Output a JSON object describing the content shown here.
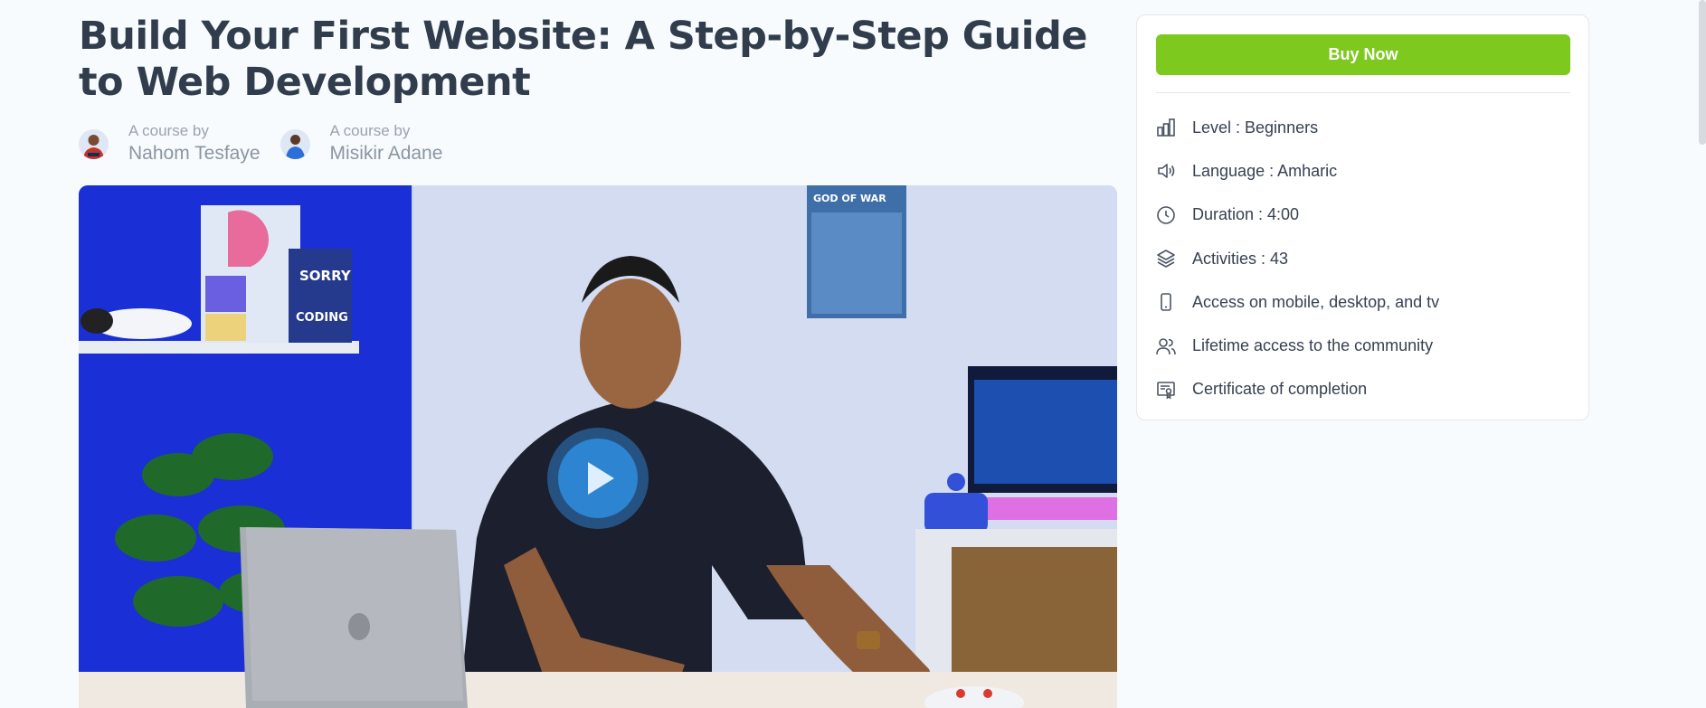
{
  "course": {
    "title": "Build Your First Website: A Step-by-Step Guide to Web Development",
    "authors": [
      {
        "by": "A course by",
        "name": "Nahom Tesfaye"
      },
      {
        "by": "A course by",
        "name": "Misikir Adane"
      }
    ]
  },
  "video": {
    "poster_text": {
      "box_line1": "SORRY",
      "box_line2": "CODING",
      "poster_top": "GOD OF WAR"
    },
    "play_icon": "play-icon"
  },
  "sidebar": {
    "buy_label": "Buy Now",
    "features": [
      {
        "icon": "level-bars-icon",
        "text": "Level : Beginners"
      },
      {
        "icon": "speaker-icon",
        "text": "Language : Amharic"
      },
      {
        "icon": "clock-icon",
        "text": "Duration : 4:00"
      },
      {
        "icon": "layers-icon",
        "text": "Activities : 43"
      },
      {
        "icon": "mobile-icon",
        "text": "Access on mobile, desktop, and tv"
      },
      {
        "icon": "users-icon",
        "text": "Lifetime access to the community"
      },
      {
        "icon": "certificate-icon",
        "text": "Certificate of completion"
      }
    ]
  },
  "colors": {
    "accent": "#7ec91e",
    "title": "#313d4d",
    "muted": "#9ca3af"
  }
}
